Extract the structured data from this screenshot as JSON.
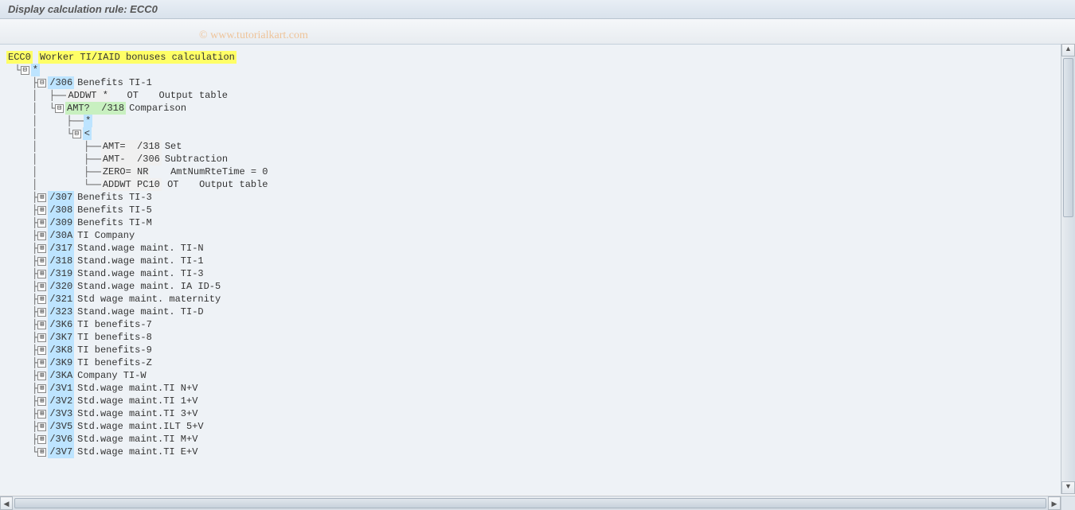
{
  "title": "Display calculation rule: ECC0",
  "watermark": "© www.tutorialkart.com",
  "root": {
    "code": "ECC0",
    "desc": "Worker TI/IAID bonuses calculation"
  },
  "star_node": "*",
  "node_306": {
    "code": "/306",
    "desc": "Benefits TI-1"
  },
  "addwt1": {
    "op": "ADDWT",
    "arg": "*",
    "col": "OT",
    "desc": "Output table"
  },
  "amtq": {
    "op": "AMT?",
    "arg": "/318",
    "desc": "Comparison"
  },
  "sub_star": "*",
  "sub_lt": "<",
  "amt_set": {
    "op": "AMT=",
    "arg": "/318",
    "desc": "Set"
  },
  "amt_minus": {
    "op": "AMT-",
    "arg": "/306",
    "desc": "Subtraction"
  },
  "zero": {
    "op": "ZERO=",
    "arg": "NR",
    "desc": "AmtNumRteTime = 0"
  },
  "addwt2": {
    "op": "ADDWT",
    "arg": "PC10",
    "col": "OT",
    "desc": "Output table"
  },
  "siblings": [
    {
      "code": "/307",
      "desc": "Benefits TI-3"
    },
    {
      "code": "/308",
      "desc": "Benefits TI-5"
    },
    {
      "code": "/309",
      "desc": "Benefits TI-M"
    },
    {
      "code": "/30A",
      "desc": "TI Company"
    },
    {
      "code": "/317",
      "desc": "Stand.wage maint. TI-N"
    },
    {
      "code": "/318",
      "desc": "Stand.wage maint. TI-1"
    },
    {
      "code": "/319",
      "desc": "Stand.wage maint. TI-3"
    },
    {
      "code": "/320",
      "desc": "Stand.wage maint. IA ID-5"
    },
    {
      "code": "/321",
      "desc": "Std wage maint. maternity"
    },
    {
      "code": "/323",
      "desc": "Stand.wage maint. TI-D"
    },
    {
      "code": "/3K6",
      "desc": "TI benefits-7"
    },
    {
      "code": "/3K7",
      "desc": "TI benefits-8"
    },
    {
      "code": "/3K8",
      "desc": "TI benefits-9"
    },
    {
      "code": "/3K9",
      "desc": "TI benefits-Z"
    },
    {
      "code": "/3KA",
      "desc": "Company TI-W"
    },
    {
      "code": "/3V1",
      "desc": "Std.wage maint.TI N+V"
    },
    {
      "code": "/3V2",
      "desc": "Std.wage maint.TI 1+V"
    },
    {
      "code": "/3V3",
      "desc": "Std.wage maint.TI 3+V"
    },
    {
      "code": "/3V5",
      "desc": "Std.wage maint.ILT 5+V"
    },
    {
      "code": "/3V6",
      "desc": "Std.wage maint.TI M+V"
    },
    {
      "code": "/3V7",
      "desc": "Std.wage maint.TI E+V"
    }
  ]
}
